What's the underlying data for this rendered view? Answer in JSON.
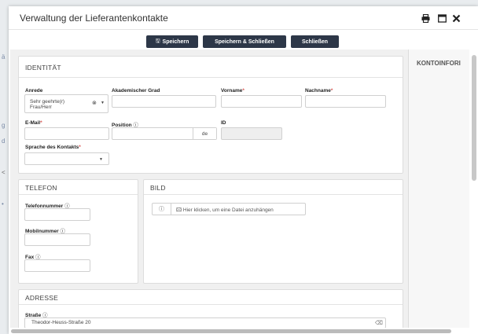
{
  "modal": {
    "title": "Verwaltung der Lieferantenkontakte"
  },
  "header_icons": [
    "printer-icon",
    "maximize-icon",
    "close-icon"
  ],
  "toolbar": {
    "save_label": "Speichern",
    "save_close_label": "Speichern & Schließen",
    "close_label": "Schließen"
  },
  "side_panel": {
    "title": "KONTOINFORI"
  },
  "identity": {
    "title": "IDENTITÄT",
    "salutation_label": "Anrede",
    "salutation_value": "Sehr geehrte(r) Frau/Herr",
    "academic_label": "Akademischer Grad",
    "firstname_label": "Vorname",
    "lastname_label": "Nachname",
    "email_label": "E-Mail",
    "position_label": "Position",
    "position_lang": "de",
    "id_label": "ID",
    "contact_lang_label": "Sprache des Kontakts",
    "required_mark": "*",
    "info_mark": "ⓘ"
  },
  "phone": {
    "title": "TELEFON",
    "phone_label": "Telefonnummer",
    "mobile_label": "Mobilnummer",
    "fax_label": "Fax"
  },
  "picture": {
    "title": "BILD",
    "attach_text": "Hier klicken, um eine Datei anzuhängen"
  },
  "address": {
    "title": "ADRESSE",
    "street_label": "Straße",
    "street_value": "Theodor-Heuss-Straße 20"
  },
  "colors": {
    "button_bg": "#2d3748",
    "required": "#d9534f"
  }
}
